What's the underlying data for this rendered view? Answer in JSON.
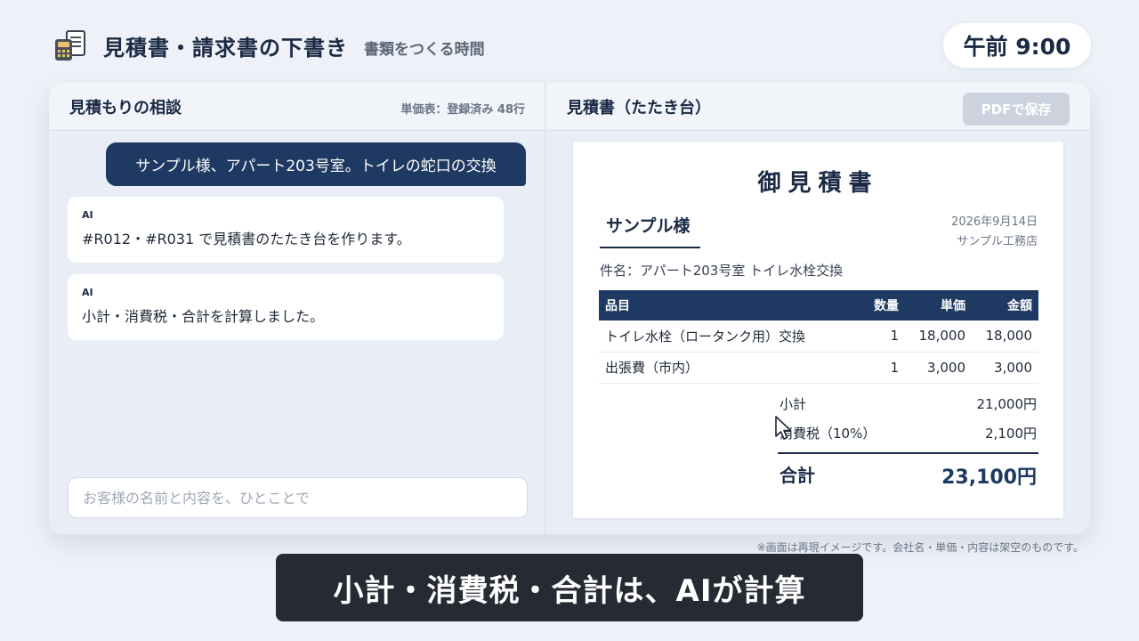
{
  "header": {
    "title": "見積書・請求書の下書き",
    "subtitle": "書類をつくる時間",
    "icon": "calculator-document-icon",
    "clock": "午前 9:00"
  },
  "chat": {
    "title": "見積もりの相談",
    "meta": "単価表：登録済み 48行",
    "messages": [
      {
        "role": "user",
        "text": "サンプル様、アパート203号室。トイレの蛇口の交換"
      },
      {
        "role": "ai",
        "label": "AI",
        "text": "#R012・#R031 で見積書のたたき台を作ります。"
      },
      {
        "role": "ai",
        "label": "AI",
        "text": "小計・消費税・合計を計算しました。"
      }
    ],
    "input_value": "",
    "input_placeholder": "お客様の名前と内容を、ひとことで"
  },
  "draft": {
    "title": "見積書（たたき台）",
    "pdf_button": "PDFで保存",
    "document": {
      "heading": "御見積書",
      "customer": "サンプル様",
      "date": "2026年9月14日",
      "issuer": "サンプル工務店",
      "subject": "件名：アパート203号室 トイレ水栓交換",
      "columns": [
        "品目",
        "数量",
        "単価",
        "金額"
      ],
      "rows": [
        {
          "name": "トイレ水栓（ロータンク用）交換",
          "qty": "1",
          "price": "18,000",
          "amount": "18,000"
        },
        {
          "name": "出張費（市内）",
          "qty": "1",
          "price": "3,000",
          "amount": "3,000"
        }
      ],
      "subtotal_label": "小計",
      "subtotal": "21,000円",
      "tax_label": "消費税（10%）",
      "tax": "2,100円",
      "total_label": "合計",
      "total": "23,100円"
    }
  },
  "colors": {
    "navy": "#1e3a62",
    "background": "#eef2f8",
    "caption_bg": "#252a33"
  },
  "footer": {
    "disclaimer": "※画面は再現イメージです。会社名・単価・内容は架空のものです。",
    "caption": "小計・消費税・合計は、AIが計算"
  }
}
